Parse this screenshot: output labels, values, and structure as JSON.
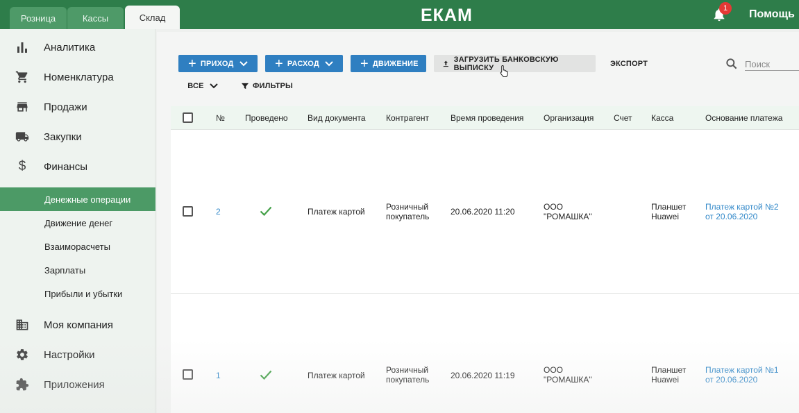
{
  "topbar": {
    "tabs": [
      {
        "label": "Розница",
        "active": false
      },
      {
        "label": "Кассы",
        "active": false
      },
      {
        "label": "Склад",
        "active": true
      }
    ],
    "logo": "ЕКАМ",
    "notifications_count": "1",
    "help_label": "Помощь"
  },
  "sidebar": {
    "items": [
      {
        "label": "Аналитика",
        "icon": "bar-chart-icon"
      },
      {
        "label": "Номенклатура",
        "icon": "cart-icon"
      },
      {
        "label": "Продажи",
        "icon": "store-icon"
      },
      {
        "label": "Закупки",
        "icon": "truck-icon"
      },
      {
        "label": "Финансы",
        "icon": "dollar-icon"
      }
    ],
    "sub_items": [
      {
        "label": "Денежные операции",
        "active": true
      },
      {
        "label": "Движение денег",
        "active": false
      },
      {
        "label": "Взаиморасчеты",
        "active": false
      },
      {
        "label": "Зарплаты",
        "active": false
      },
      {
        "label": "Прибыли и убытки",
        "active": false
      }
    ],
    "bottom_items": [
      {
        "label": "Моя компания",
        "icon": "building-icon"
      },
      {
        "label": "Настройки",
        "icon": "gear-icon"
      },
      {
        "label": "Приложения",
        "icon": "puzzle-icon"
      }
    ]
  },
  "toolbar": {
    "income_label": "ПРИХОД",
    "expense_label": "РАСХОД",
    "movement_label": "ДВИЖЕНИЕ",
    "upload_label": "ЗАГРУЗИТЬ БАНКОВСКУЮ ВЫПИСКУ",
    "export_label": "ЭКСПОРТ",
    "all_label": "ВСЕ",
    "filters_label": "ФИЛЬТРЫ",
    "search_placeholder": "Поиск"
  },
  "table": {
    "columns": [
      "№",
      "Проведено",
      "Вид документа",
      "Контрагент",
      "Время проведения",
      "Организация",
      "Счет",
      "Касса",
      "Основание платежа"
    ],
    "rows": [
      {
        "number": "2",
        "doc_type": "Платеж картой",
        "counterparty_line1": "Розничный",
        "counterparty_line2": "покупатель",
        "time": "20.06.2020 11:20",
        "org_line1": "ООО",
        "org_line2": "\"РОМАШКА\"",
        "account": "",
        "register_line1": "Планшет",
        "register_line2": "Huawei",
        "basis_line1": "Платеж картой №2",
        "basis_line2": "от 20.06.2020"
      },
      {
        "number": "1",
        "doc_type": "Платеж картой",
        "counterparty_line1": "Розничный",
        "counterparty_line2": "покупатель",
        "time": "20.06.2020 11:19",
        "org_line1": "ООО",
        "org_line2": "\"РОМАШКА\"",
        "account": "",
        "register_line1": "Планшет",
        "register_line2": "Huawei",
        "basis_line1": "Платеж картой №1",
        "basis_line2": "от 20.06.2020"
      }
    ]
  },
  "colors": {
    "topbar": "#2e7d4a",
    "accent_blue": "#2f7fc1",
    "active_nav": "#4c9a66",
    "check_green": "#43a047",
    "link_blue": "#3389c9"
  }
}
